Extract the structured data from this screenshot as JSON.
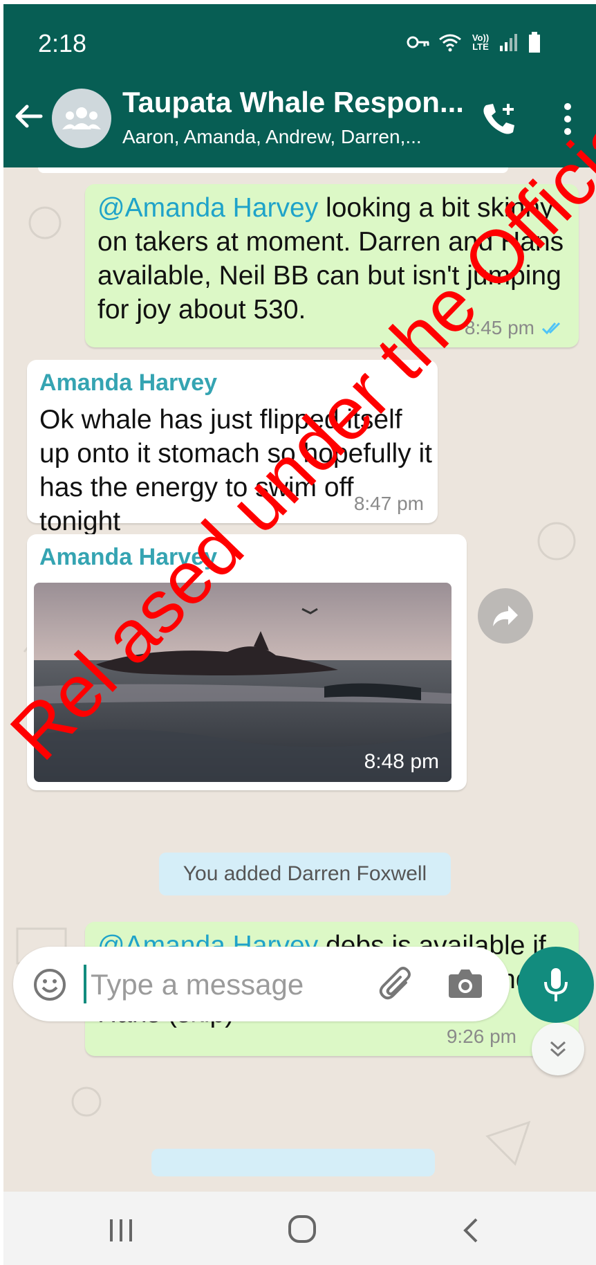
{
  "status_bar": {
    "time": "2:18",
    "icons": [
      "key-icon",
      "wifi-icon",
      "volte-icon",
      "signal-icon",
      "battery-icon"
    ],
    "volte_label": "Vo)) LTE"
  },
  "header": {
    "title": "Taupata Whale Respon...",
    "subtitle": "Aaron, Amanda, Andrew, Darren,...",
    "colors": {
      "bar": "#075e54"
    }
  },
  "messages": [
    {
      "type": "outgoing",
      "mention": "@Amanda Harvey",
      "text": " looking a bit skinny on takers at moment. Darren and Hans available, Neil BB can but isn't jumping for joy about 530.",
      "time": "8:45 pm",
      "status": "read"
    },
    {
      "type": "incoming",
      "sender": "Amanda Harvey",
      "text": "Ok whale has just flipped itself up onto it stomach so hopefully it has the energy to swim off tonight",
      "time": "8:47 pm"
    },
    {
      "type": "incoming-photo",
      "sender": "Amanda Harvey",
      "time": "8:48 pm",
      "image_subject": "whale stranded on beach"
    },
    {
      "type": "system",
      "text": "You added Darren Foxwell"
    },
    {
      "type": "outgoing",
      "mention": "@Amanda Harvey",
      "text": " debs  is available if required. So have Debs, Darren and Hans (skip)",
      "time": "9:26 pm"
    }
  ],
  "composer": {
    "placeholder": "Type a message"
  },
  "watermark": "Rel  ased under the Official Info",
  "colors": {
    "outgoing_bubble": "#dcf8c6",
    "incoming_bubble": "#ffffff",
    "mention": "#1fa3c9",
    "sender": "#35a4b2",
    "accent": "#128c7e",
    "chat_bg": "#ece5dd"
  }
}
